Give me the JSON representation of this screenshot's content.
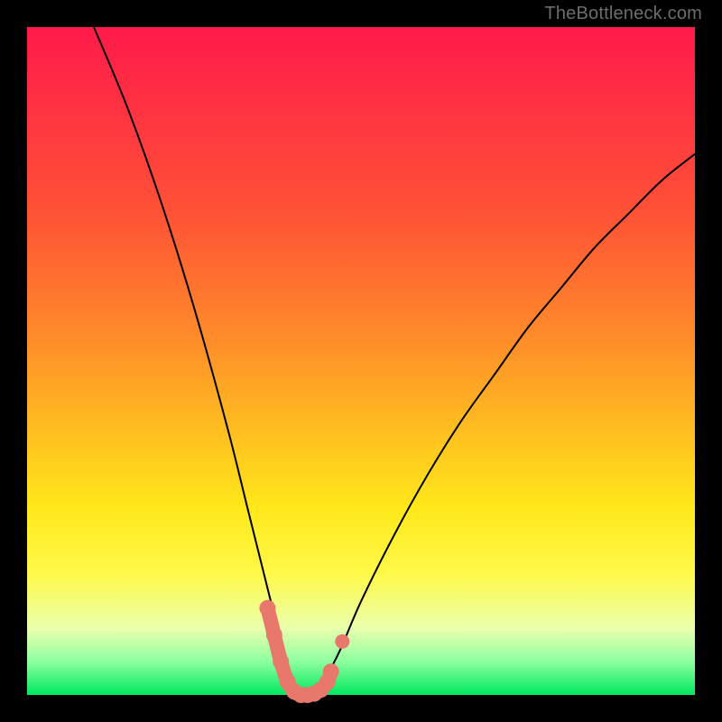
{
  "watermark": "TheBottleneck.com",
  "chart_data": {
    "type": "line",
    "title": "",
    "xlabel": "",
    "ylabel": "",
    "xlim": [
      0,
      100
    ],
    "ylim": [
      0,
      100
    ],
    "grid": false,
    "series": [
      {
        "name": "bottleneck-curve",
        "x": [
          10,
          15,
          20,
          25,
          30,
          33,
          35,
          37,
          38,
          39,
          40,
          41,
          42,
          43,
          44,
          45,
          47,
          50,
          55,
          60,
          65,
          70,
          75,
          80,
          85,
          90,
          95,
          100
        ],
        "y": [
          100,
          88,
          74,
          58,
          40,
          28,
          20,
          12,
          8,
          4,
          1,
          0,
          0,
          0,
          1,
          3,
          7,
          14,
          24,
          33,
          41,
          48,
          55,
          61,
          67,
          72,
          77,
          81
        ],
        "stroke": "#000000",
        "stroke_width": 2
      },
      {
        "name": "highlight-segment",
        "x": [
          36.0,
          37.0,
          38.0,
          39.0,
          40.0,
          41.0,
          42.0,
          43.0,
          44.0,
          45.0,
          45.5
        ],
        "y": [
          13.0,
          9.0,
          5.0,
          2.0,
          0.5,
          0.0,
          0.0,
          0.2,
          0.8,
          2.0,
          3.5
        ],
        "stroke": "#e7786b",
        "stroke_width": 16,
        "linecap": "round",
        "markers": true,
        "marker_r": 9,
        "marker_fill": "#e7786b"
      }
    ],
    "extra_markers": [
      {
        "x": 47.2,
        "y": 8.0,
        "r": 8,
        "fill": "#e7786b"
      }
    ]
  }
}
